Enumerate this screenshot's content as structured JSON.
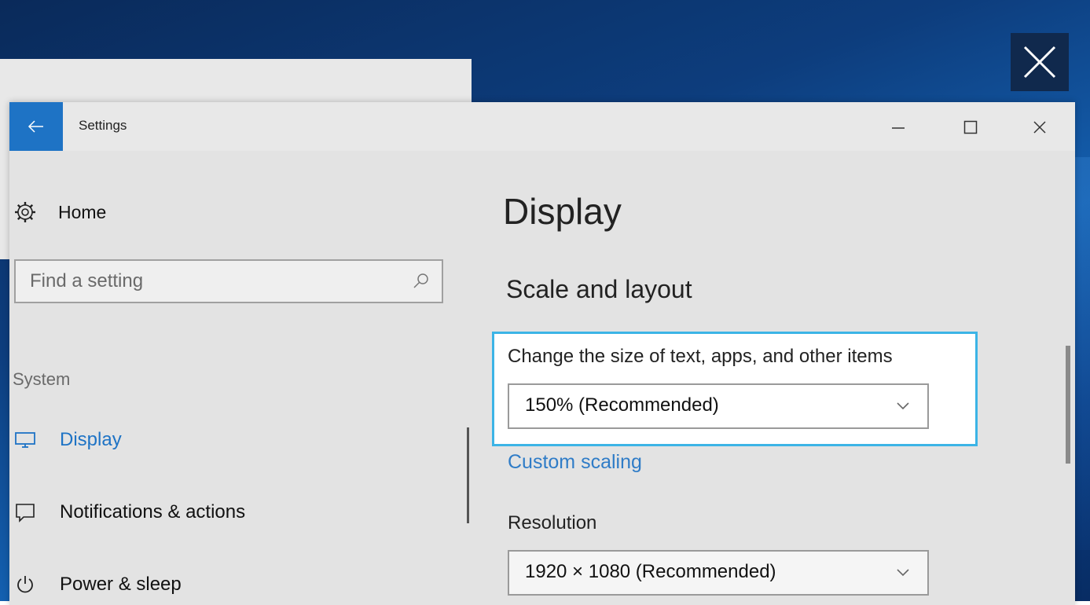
{
  "window": {
    "title": "Settings",
    "back_icon": "back-arrow-icon",
    "controls": [
      "minimize-icon",
      "maximize-icon",
      "close-icon"
    ]
  },
  "nav": {
    "home_label": "Home",
    "search_placeholder": "Find a setting",
    "section_label": "System",
    "items": [
      {
        "label": "Display",
        "icon": "monitor-icon",
        "active": true
      },
      {
        "label": "Notifications & actions",
        "icon": "message-icon",
        "active": false
      },
      {
        "label": "Power & sleep",
        "icon": "power-icon",
        "active": false
      }
    ]
  },
  "content": {
    "title": "Display",
    "subtitle": "Scale and layout",
    "scale_label": "Change the size of text, apps, and other items",
    "scale_value": "150% (Recommended)",
    "custom_scaling_link": "Custom scaling",
    "resolution_label": "Resolution",
    "resolution_value": "1920 × 1080 (Recommended)"
  },
  "colors": {
    "accent": "#1e73c5",
    "link": "#2f7cc7",
    "highlight_border": "#3cb4e6",
    "window_bg": "#e3e3e3"
  }
}
